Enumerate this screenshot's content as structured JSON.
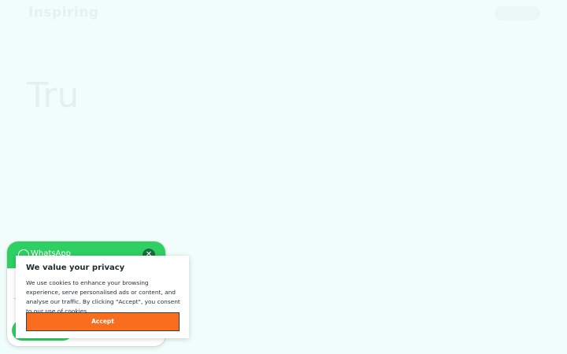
{
  "header": {
    "logo": "Inspiring",
    "cta_label": ""
  },
  "hero": {
    "title": "Tru"
  },
  "whatsapp": {
    "title": "WhatsApp",
    "close_glyph": "✕",
    "icons": [
      "whatsapp-icon",
      "close-icon"
    ]
  },
  "cookie": {
    "title": "We value your privacy",
    "body": "We use cookies to enhance your browsing experience, serve personalised ads or content, and analyse our traffic. By clicking \"Accept\", you consent to our use of cookies.",
    "accept_label": "Accept"
  },
  "colors": {
    "background": "#f1fdfb",
    "whatsapp_green": "#2ecf63",
    "accept_orange": "#f96e1e"
  }
}
